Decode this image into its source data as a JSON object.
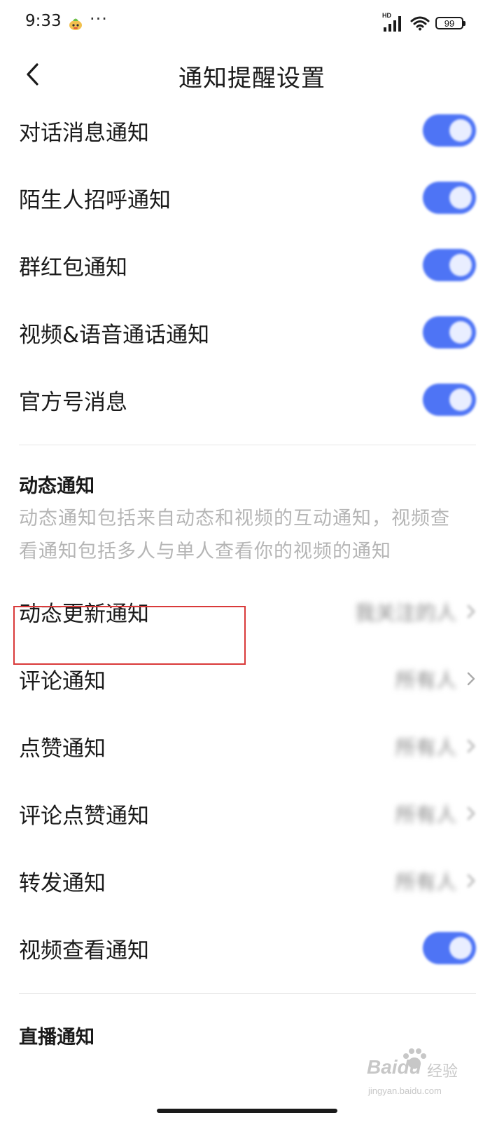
{
  "status_bar": {
    "time": "9:33",
    "more": "···",
    "signal_label": "HD",
    "battery": "99"
  },
  "nav": {
    "title": "通知提醒设置"
  },
  "toggle_rows": [
    {
      "label": "对话消息通知",
      "enabled": true
    },
    {
      "label": "陌生人招呼通知",
      "enabled": true
    },
    {
      "label": "群红包通知",
      "enabled": true
    },
    {
      "label": "视频&语音通话通知",
      "enabled": true
    },
    {
      "label": "官方号消息",
      "enabled": true
    }
  ],
  "moments_section": {
    "title": "动态通知",
    "description": "动态通知包括来自动态和视频的互动通知，视频查看通知包括多人与单人查看你的视频的通知",
    "rows": [
      {
        "label": "动态更新通知",
        "value": "我关注的人"
      },
      {
        "label": "评论通知",
        "value": "所有人"
      },
      {
        "label": "点赞通知",
        "value": "所有人"
      },
      {
        "label": "评论点赞通知",
        "value": "所有人"
      },
      {
        "label": "转发通知",
        "value": "所有人"
      }
    ],
    "video_view_row": {
      "label": "视频查看通知",
      "enabled": true
    }
  },
  "live_section": {
    "title": "直播通知"
  },
  "watermark": {
    "brand": "Baidu",
    "sub": "经验",
    "url": "jingyan.baidu.com"
  },
  "colors": {
    "toggle_on": "#4e74f5",
    "highlight": "#d93a3a",
    "description": "#b5b5b5"
  }
}
